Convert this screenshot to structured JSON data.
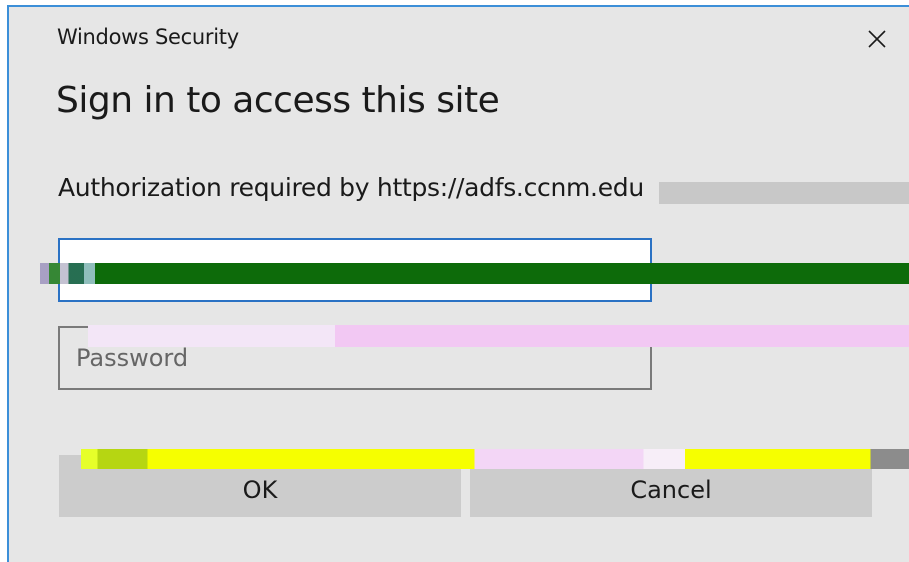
{
  "window": {
    "title": "Windows Security",
    "close_icon": "close-icon"
  },
  "dialog": {
    "heading": "Sign in to access this site",
    "authorization_text": "Authorization required by https://adfs.ccnm.edu"
  },
  "fields": {
    "username": {
      "value": "",
      "placeholder": ""
    },
    "password": {
      "value": "",
      "placeholder": "Password"
    }
  },
  "buttons": {
    "ok_label": "OK",
    "cancel_label": "Cancel"
  },
  "colors": {
    "dialog_background": "#e6e6e6",
    "accent_border": "#3c8fd8",
    "focused_field_border": "#2b72c4",
    "button_background": "#cccccc"
  }
}
